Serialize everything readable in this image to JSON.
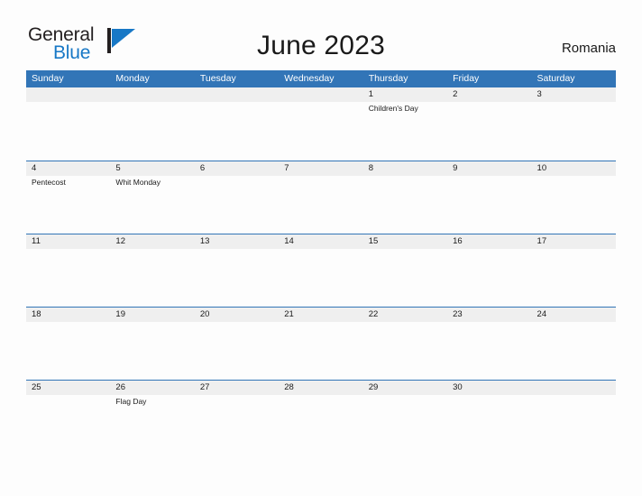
{
  "brand": {
    "line1": "General",
    "line2": "Blue",
    "flag_icon": "blue-flag-triangle-icon",
    "flag_color": "#1878c6",
    "text_color": "#231f20"
  },
  "header": {
    "title": "June 2023",
    "region": "Romania"
  },
  "theme": {
    "header_blue": "#3275b7",
    "date_band_gray": "#efefef",
    "page_background": "#fdfdfd",
    "text": "#1a1a1a"
  },
  "calendar": {
    "weekdays": [
      "Sunday",
      "Monday",
      "Tuesday",
      "Wednesday",
      "Thursday",
      "Friday",
      "Saturday"
    ],
    "weeks": [
      [
        {
          "day": "",
          "events": []
        },
        {
          "day": "",
          "events": []
        },
        {
          "day": "",
          "events": []
        },
        {
          "day": "",
          "events": []
        },
        {
          "day": "1",
          "events": [
            "Children's Day"
          ]
        },
        {
          "day": "2",
          "events": []
        },
        {
          "day": "3",
          "events": []
        }
      ],
      [
        {
          "day": "4",
          "events": [
            "Pentecost"
          ]
        },
        {
          "day": "5",
          "events": [
            "Whit Monday"
          ]
        },
        {
          "day": "6",
          "events": []
        },
        {
          "day": "7",
          "events": []
        },
        {
          "day": "8",
          "events": []
        },
        {
          "day": "9",
          "events": []
        },
        {
          "day": "10",
          "events": []
        }
      ],
      [
        {
          "day": "11",
          "events": []
        },
        {
          "day": "12",
          "events": []
        },
        {
          "day": "13",
          "events": []
        },
        {
          "day": "14",
          "events": []
        },
        {
          "day": "15",
          "events": []
        },
        {
          "day": "16",
          "events": []
        },
        {
          "day": "17",
          "events": []
        }
      ],
      [
        {
          "day": "18",
          "events": []
        },
        {
          "day": "19",
          "events": []
        },
        {
          "day": "20",
          "events": []
        },
        {
          "day": "21",
          "events": []
        },
        {
          "day": "22",
          "events": []
        },
        {
          "day": "23",
          "events": []
        },
        {
          "day": "24",
          "events": []
        }
      ],
      [
        {
          "day": "25",
          "events": []
        },
        {
          "day": "26",
          "events": [
            "Flag Day"
          ]
        },
        {
          "day": "27",
          "events": []
        },
        {
          "day": "28",
          "events": []
        },
        {
          "day": "29",
          "events": []
        },
        {
          "day": "30",
          "events": []
        },
        {
          "day": "",
          "events": []
        }
      ]
    ]
  }
}
